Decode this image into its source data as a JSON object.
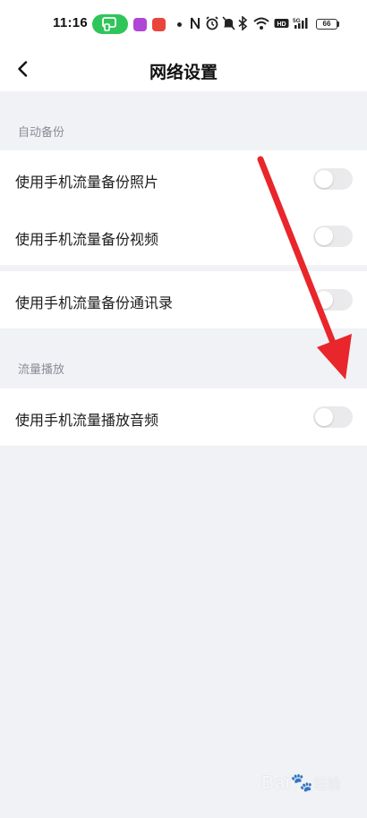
{
  "status_bar": {
    "time": "11:16",
    "battery": "66",
    "icons": [
      "screen-cast-icon",
      "app-notification-icon",
      "app-notification-icon",
      "dot-icon",
      "nfc-icon",
      "alarm-icon",
      "mute-icon",
      "bluetooth-icon",
      "wifi-icon",
      "hd-icon",
      "signal-5g-icon",
      "battery-icon"
    ],
    "cast_color": "#2fc55b"
  },
  "header": {
    "title": "网络设置",
    "back_icon": "chevron-left-icon"
  },
  "sections": [
    {
      "title": "自动备份",
      "items": [
        {
          "label": "使用手机流量备份照片",
          "enabled": false
        },
        {
          "label": "使用手机流量备份视频",
          "enabled": false
        },
        {
          "label": "使用手机流量备份通讯录",
          "enabled": false
        }
      ]
    },
    {
      "title": "流量播放",
      "items": [
        {
          "label": "使用手机流量播放音频",
          "enabled": false
        }
      ]
    }
  ],
  "annotation": {
    "type": "arrow",
    "color": "#e8262b"
  },
  "watermark": {
    "brand": "Bai",
    "suffix": "经验"
  }
}
